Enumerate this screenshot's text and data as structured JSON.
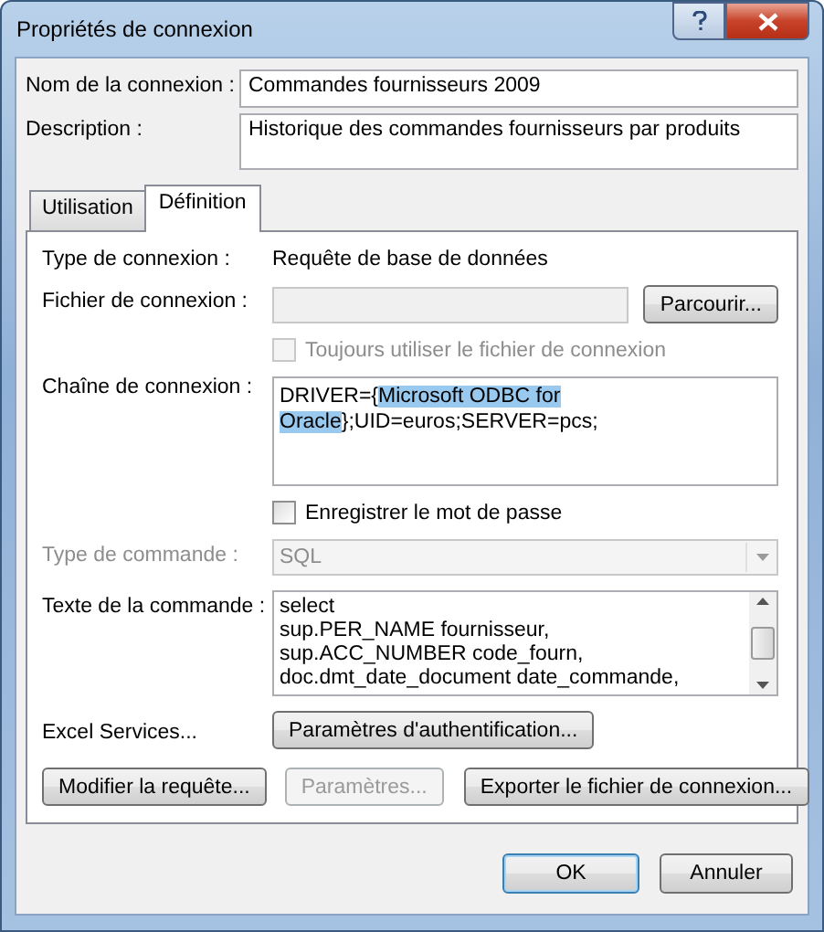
{
  "window": {
    "title": "Propriétés de connexion"
  },
  "name_field": {
    "label": "Nom de la connexion :",
    "value": "Commandes fournisseurs 2009"
  },
  "description_field": {
    "label": "Description :",
    "value": "Historique des commandes fournisseurs par produits"
  },
  "tabs": [
    {
      "label": "Utilisation",
      "selected": false
    },
    {
      "label": "Définition",
      "selected": true
    }
  ],
  "definition": {
    "connection_type": {
      "label": "Type de connexion :",
      "value": "Requête de base de données"
    },
    "connection_file": {
      "label": "Fichier de connexion :",
      "disabled": true,
      "button": "Parcourir..."
    },
    "always_use_file": {
      "label": "Toujours utiliser le fichier de connexion",
      "checked": false,
      "disabled": true
    },
    "connection_string": {
      "label": "Chaîne de connexion :",
      "text_before": "DRIVER={",
      "selection": "Microsoft ODBC for Oracle",
      "text_after": "};UID=euros;SERVER=pcs;"
    },
    "save_password": {
      "label": "Enregistrer le mot de passe",
      "checked": false,
      "disabled": false
    },
    "command_type": {
      "label": "Type de commande :",
      "value": "SQL",
      "disabled": true
    },
    "command_text": {
      "label": "Texte de la commande :",
      "lines": [
        "select",
        "sup.PER_NAME fournisseur,",
        "sup.ACC_NUMBER code_fourn,",
        "doc.dmt_date_document date_commande,"
      ]
    },
    "excel_services": {
      "label": "Excel Services...",
      "button": "Paramètres d'authentification..."
    },
    "buttons": [
      {
        "label": "Modifier la requête...",
        "disabled": false
      },
      {
        "label": "Paramètres...",
        "disabled": true
      },
      {
        "label": "Exporter le fichier de connexion...",
        "disabled": false
      }
    ]
  },
  "dialog_buttons": [
    {
      "label": "OK",
      "kind": "default"
    },
    {
      "label": "Annuler",
      "kind": "normal"
    }
  ]
}
